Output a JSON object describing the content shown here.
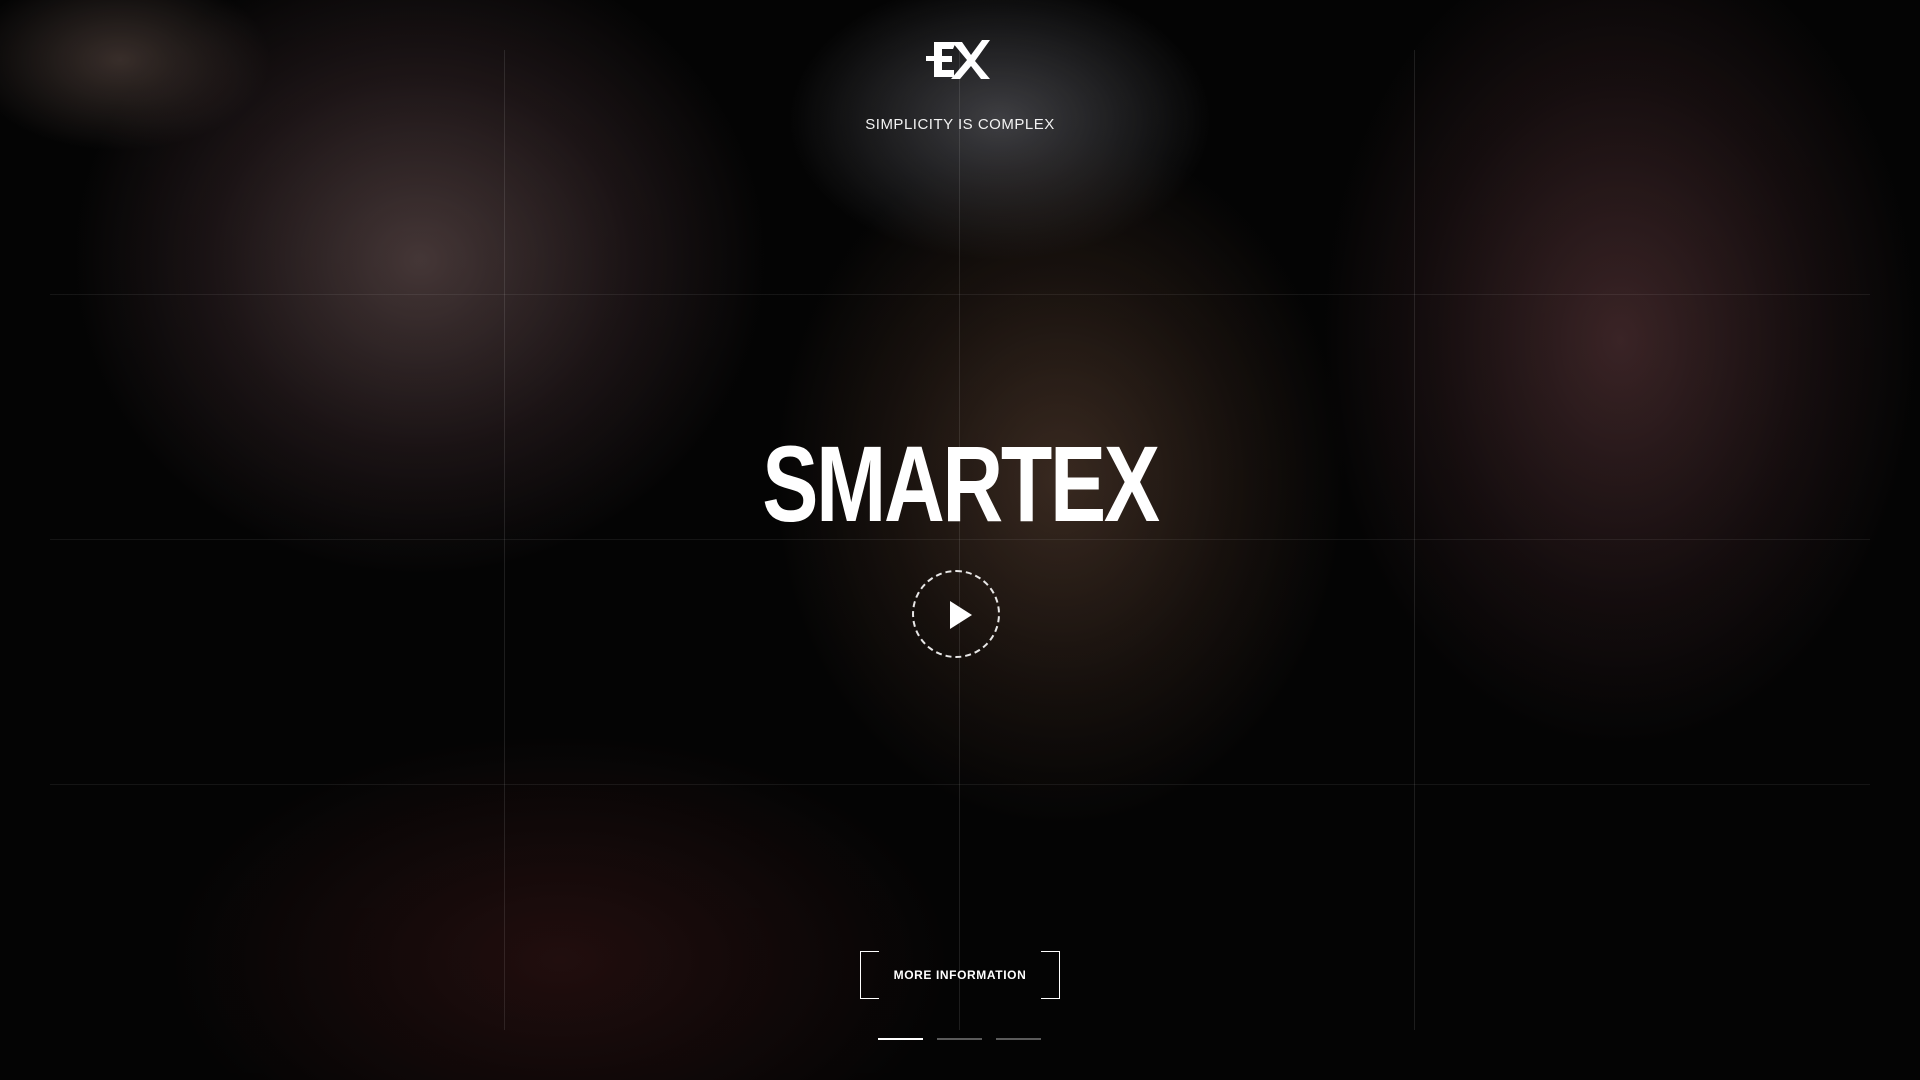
{
  "hero": {
    "tagline": "SIMPLICITY IS COMPLEX",
    "title": "SMARTEX",
    "cta_label": "MORE INFORMATION"
  },
  "slider": {
    "slides": 3,
    "active_index": 0
  },
  "icons": {
    "logo": "ex-logo",
    "play": "play-icon"
  },
  "colors": {
    "text": "#ffffff",
    "background": "#050505"
  }
}
